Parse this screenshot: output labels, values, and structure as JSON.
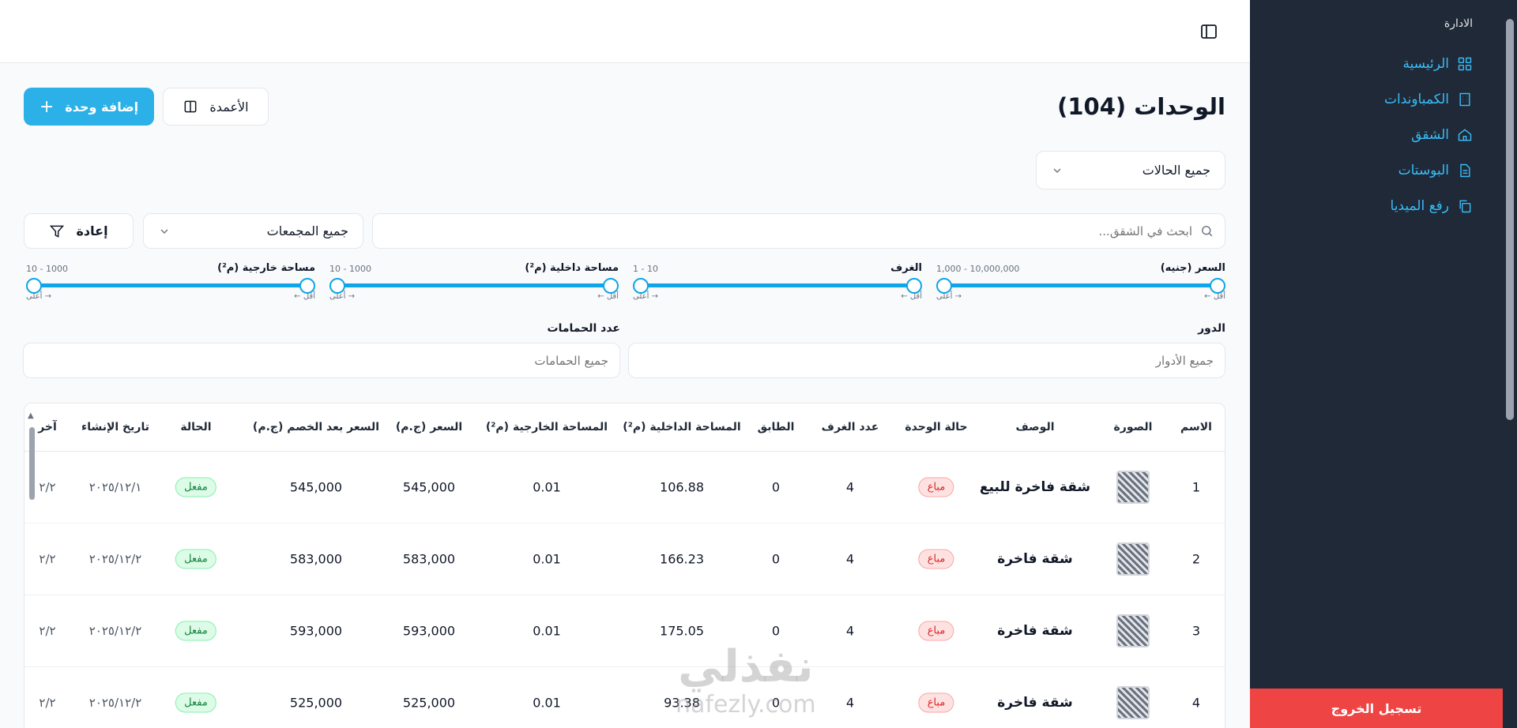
{
  "sidebar": {
    "group_title": "الادارة",
    "items": [
      {
        "label": "الرئيسية",
        "icon": "dashboard-icon"
      },
      {
        "label": "الكمباوندات",
        "icon": "building-icon"
      },
      {
        "label": "الشقق",
        "icon": "home-icon"
      },
      {
        "label": "البوستات",
        "icon": "document-icon"
      },
      {
        "label": "رفع الميديا",
        "icon": "copy-icon"
      }
    ],
    "logout_label": "تسجيل الخروج"
  },
  "header": {
    "title": "الوحدات (104)",
    "add_button": "إضافة وحدة",
    "columns_button": "الأعمدة"
  },
  "filters": {
    "status_select": "جميع الحالات",
    "search_placeholder": "ابحث في الشقق...",
    "group_select": "جميع المجمعات",
    "reset_button": "إعادة",
    "floor_label": "الدور",
    "floor_placeholder": "جميع الأدوار",
    "bathrooms_label": "عدد الحمامات",
    "bathrooms_placeholder": "جميع الحمامات",
    "sliders": [
      {
        "label": "السعر (جنيه)",
        "range": "1,000 - 10,000,000",
        "hint_min": "أقل ←",
        "hint_max": "→ أعلى"
      },
      {
        "label": "الغرف",
        "range": "1 - 10",
        "hint_min": "أقل ←",
        "hint_max": "→ أعلى"
      },
      {
        "label": "مساحة داخلية (م²)",
        "range": "10 - 1000",
        "hint_min": "أقل ←",
        "hint_max": "→ أعلى"
      },
      {
        "label": "مساحة خارجية (م²)",
        "range": "10 - 1000",
        "hint_min": "أقل ←",
        "hint_max": "→ أعلى"
      }
    ]
  },
  "table": {
    "headers": {
      "name": "الاسم",
      "image": "الصورة",
      "description": "الوصف",
      "unit_status": "حالة الوحدة",
      "rooms": "عدد الغرف",
      "floor": "الطابق",
      "inner_area": "المساحة الداخلية (م²)",
      "outer_area": "المساحة الخارجية (م²)",
      "price": "السعر (ج.م)",
      "discount_price": "السعر بعد الخصم (ج.م)",
      "state": "الحالة",
      "created": "تاريخ الإنشاء",
      "last": "آخر"
    },
    "rows": [
      {
        "name": "1",
        "description": "شقة فاخرة للبيع",
        "unit_status": "مباع",
        "rooms": "4",
        "floor": "0",
        "inner_area": "106.88",
        "outer_area": "0.01",
        "price": "545,000",
        "discount_price": "545,000",
        "state": "مفعل",
        "created": "٢٠٢٥/١٢/١",
        "last": "٢/٢"
      },
      {
        "name": "2",
        "description": "شقة فاخرة",
        "unit_status": "مباع",
        "rooms": "4",
        "floor": "0",
        "inner_area": "166.23",
        "outer_area": "0.01",
        "price": "583,000",
        "discount_price": "583,000",
        "state": "مفعل",
        "created": "٢٠٢٥/١٢/٢",
        "last": "٢/٢"
      },
      {
        "name": "3",
        "description": "شقة فاخرة",
        "unit_status": "مباع",
        "rooms": "4",
        "floor": "0",
        "inner_area": "175.05",
        "outer_area": "0.01",
        "price": "593,000",
        "discount_price": "593,000",
        "state": "مفعل",
        "created": "٢٠٢٥/١٢/٢",
        "last": "٢/٢"
      },
      {
        "name": "4",
        "description": "شقة فاخرة",
        "unit_status": "مباع",
        "rooms": "4",
        "floor": "0",
        "inner_area": "93.38",
        "outer_area": "0.01",
        "price": "525,000",
        "discount_price": "525,000",
        "state": "مفعل",
        "created": "٢٠٢٥/١٢/٢",
        "last": "٢/٢"
      }
    ]
  },
  "watermark": {
    "line1": "نفذلي",
    "line2": "nafezly.com"
  },
  "colors": {
    "accent": "#2bb0e8",
    "sidebar_bg": "#1f2937",
    "logout": "#ef4444"
  }
}
